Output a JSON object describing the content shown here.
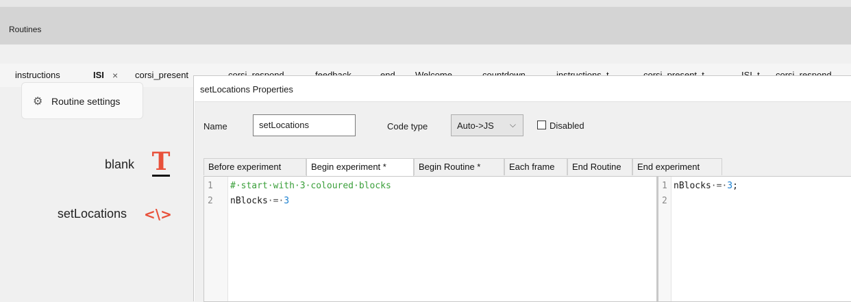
{
  "routines_panel": {
    "label": "Routines"
  },
  "routine_tabs": [
    {
      "label": "instructions"
    },
    {
      "label": "ISI",
      "active": true,
      "close_glyph": "×"
    },
    {
      "label": "corsi_present"
    },
    {
      "label": "corsi_respond"
    },
    {
      "label": "feedback"
    },
    {
      "label": "end"
    },
    {
      "label": "Welcome"
    },
    {
      "label": "countdown"
    },
    {
      "label": "instructions_t"
    },
    {
      "label": "corsi_present_t"
    },
    {
      "label": "ISI_t"
    },
    {
      "label": "corsi_respond_"
    }
  ],
  "routine_settings": {
    "label": "Routine settings",
    "icon": "gear-icon"
  },
  "components": [
    {
      "label": "blank",
      "icon": "text-component-icon",
      "glyph": "T"
    },
    {
      "label": "setLocations",
      "icon": "code-component-icon",
      "glyph": "<\\>"
    }
  ],
  "dialog": {
    "title": "setLocations Properties",
    "name_label": "Name",
    "name_value": "setLocations",
    "code_type_label": "Code type",
    "code_type_value": "Auto->JS",
    "disabled_label": "Disabled",
    "disabled_checked": false,
    "tabs": [
      {
        "label": "Before experiment"
      },
      {
        "label": "Begin experiment *",
        "active": true
      },
      {
        "label": "Begin Routine *"
      },
      {
        "label": "Each frame"
      },
      {
        "label": "End Routine"
      },
      {
        "label": "End experiment"
      }
    ],
    "python_code": {
      "line_numbers": [
        "1",
        "2"
      ],
      "line1_comment": "#·start·with·3·coloured·blocks",
      "line2_var": "nBlocks",
      "line2_op": "·=·",
      "line2_num": "3"
    },
    "js_code": {
      "line_numbers": [
        "1",
        "2"
      ],
      "line1_var": "nBlocks",
      "line1_op": "·=·",
      "line1_num": "3",
      "line1_end": ";"
    }
  },
  "colors": {
    "accent_red": "#e8503a",
    "comment_green": "#3a9f3a",
    "number_blue": "#1a7fd0"
  }
}
